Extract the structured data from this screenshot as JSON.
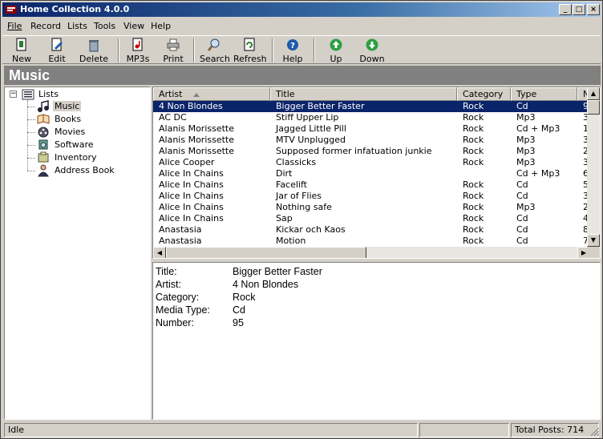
{
  "window": {
    "title": "Home Collection 4.0.0"
  },
  "titlebar_buttons": [
    "_",
    "□",
    "×"
  ],
  "menu": [
    {
      "label": "File",
      "name": "menu-file"
    },
    {
      "label": "Record",
      "name": "menu-record"
    },
    {
      "label": "Lists",
      "name": "menu-lists"
    },
    {
      "label": "Tools",
      "name": "menu-tools"
    },
    {
      "label": "View",
      "name": "menu-view"
    },
    {
      "label": "Help",
      "name": "menu-help"
    }
  ],
  "toolbar": {
    "new": "New",
    "edit": "Edit",
    "delete": "Delete",
    "mp3s": "MP3s",
    "print": "Print",
    "search": "Search",
    "refresh": "Refresh",
    "help": "Help",
    "up": "Up",
    "down": "Down"
  },
  "section": {
    "title": "Music"
  },
  "tree": {
    "root": "Lists",
    "items": [
      "Music",
      "Books",
      "Movies",
      "Software",
      "Inventory",
      "Address Book"
    ],
    "selected": "Music"
  },
  "table": {
    "columns": [
      "Artist",
      "Title",
      "Category",
      "Type",
      "N"
    ],
    "sorted_by": "Artist",
    "rows": [
      [
        "4 Non Blondes",
        "Bigger Better Faster",
        "Rock",
        "Cd",
        "9"
      ],
      [
        "AC DC",
        "Stiff Upper Lip",
        "Rock",
        "Mp3",
        "3"
      ],
      [
        "Alanis Morissette",
        "Jagged Little Pill",
        "Rock",
        "Cd + Mp3",
        "1"
      ],
      [
        "Alanis Morissette",
        "MTV Unplugged",
        "Rock",
        "Mp3",
        "3"
      ],
      [
        "Alanis Morissette",
        "Supposed former infatuation junkie",
        "Rock",
        "Mp3",
        "2"
      ],
      [
        "Alice Cooper",
        "Classicks",
        "Rock",
        "Mp3",
        "3"
      ],
      [
        "Alice In Chains",
        "Dirt",
        "",
        "Cd + Mp3",
        "6"
      ],
      [
        "Alice In Chains",
        "Facelift",
        "Rock",
        "Cd",
        "5"
      ],
      [
        "Alice In Chains",
        "Jar of Flies",
        "Rock",
        "Cd",
        "3"
      ],
      [
        "Alice In Chains",
        "Nothing safe",
        "Rock",
        "Mp3",
        "2"
      ],
      [
        "Alice In Chains",
        "Sap",
        "Rock",
        "Cd",
        "4"
      ],
      [
        "Anastasia",
        "Kickar och Kaos",
        "Rock",
        "Cd",
        "8"
      ],
      [
        "Anastasia",
        "Motion",
        "Rock",
        "Cd",
        "7"
      ]
    ],
    "selected_row": 0
  },
  "details": {
    "fields": [
      {
        "key": "Title:",
        "value": "Bigger Better Faster"
      },
      {
        "key": "Artist:",
        "value": "4 Non Blondes"
      },
      {
        "key": "Category:",
        "value": "Rock"
      },
      {
        "key": "Media Type:",
        "value": "Cd"
      },
      {
        "key": "Number:",
        "value": "95"
      }
    ]
  },
  "status": {
    "state": "Idle",
    "middle": "",
    "total": "Total Posts: 714"
  },
  "colors": {
    "selection": "#0a246a",
    "header": "#808080",
    "face": "#d4d0c8"
  }
}
